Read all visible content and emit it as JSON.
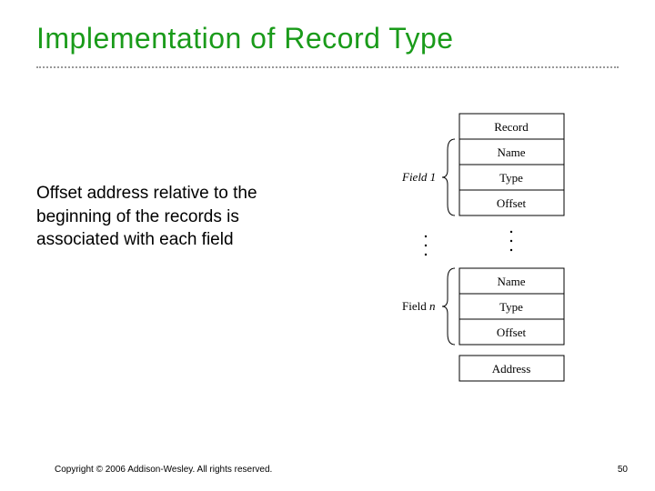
{
  "title": "Implementation of Record Type",
  "body": "Offset address relative to the beginning of the records is associated with each field",
  "diagram": {
    "field1_label": "Field 1",
    "fieldn_label": "Field n",
    "n_italic": "n",
    "boxes_group1": [
      "Record",
      "Name",
      "Type",
      "Offset"
    ],
    "boxes_group2": [
      "Name",
      "Type",
      "Offset",
      "Address"
    ]
  },
  "footer": {
    "copyright": "Copyright © 2006 Addison-Wesley. All rights reserved.",
    "page": "50"
  }
}
